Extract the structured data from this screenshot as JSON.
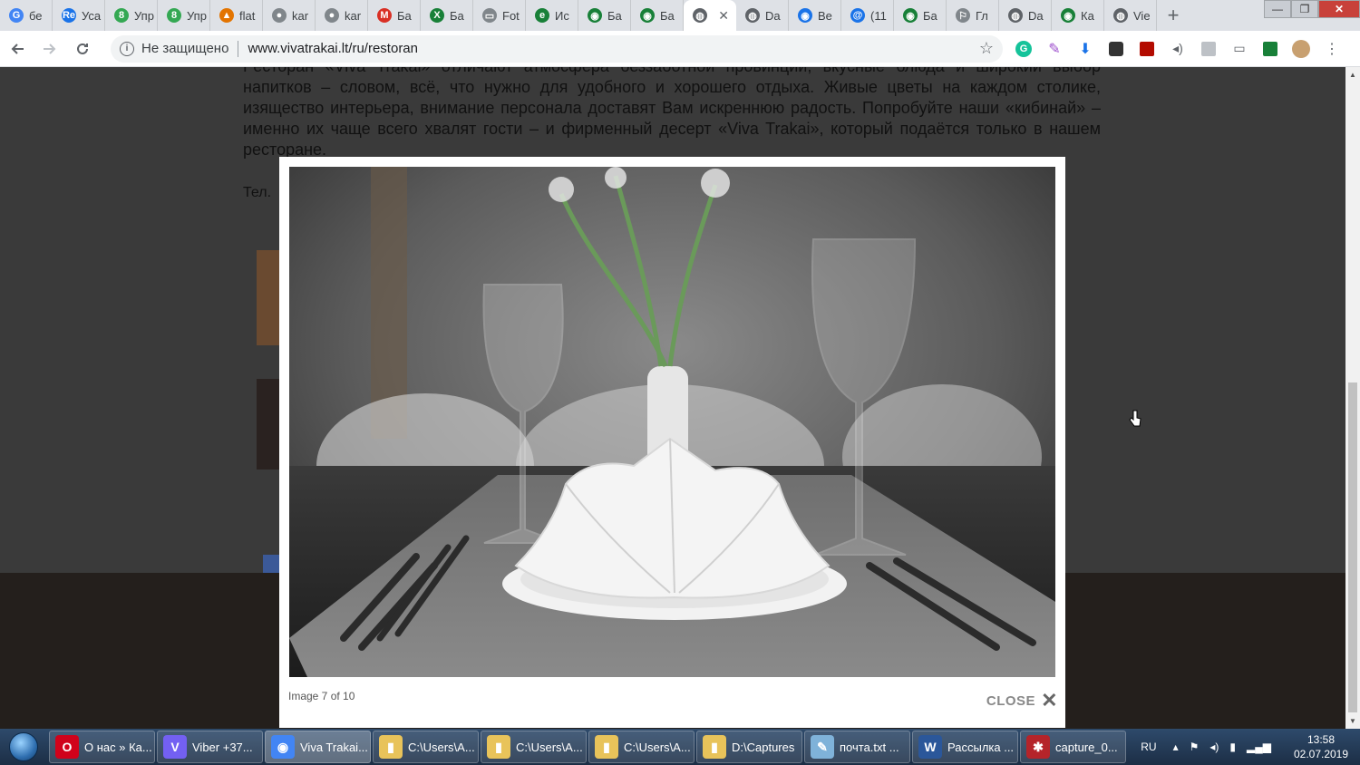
{
  "browser": {
    "tabs": [
      {
        "label": "бе",
        "icon": "G",
        "color": "#4285f4"
      },
      {
        "label": "Уса",
        "icon": "Re",
        "color": "#1a73e8"
      },
      {
        "label": "Упр",
        "icon": "8",
        "color": "#34a853"
      },
      {
        "label": "Упр",
        "icon": "8",
        "color": "#34a853"
      },
      {
        "label": "flat",
        "icon": "▲",
        "color": "#e37400"
      },
      {
        "label": "kar",
        "icon": "●",
        "color": "#80868b"
      },
      {
        "label": "kar",
        "icon": "●",
        "color": "#80868b"
      },
      {
        "label": "Ба",
        "icon": "M",
        "color": "#d93025"
      },
      {
        "label": "Ба",
        "icon": "X",
        "color": "#188038"
      },
      {
        "label": "Fot",
        "icon": "▭",
        "color": "#80868b"
      },
      {
        "label": "Ис",
        "icon": "e",
        "color": "#188038"
      },
      {
        "label": "Ба",
        "icon": "◉",
        "color": "#188038"
      },
      {
        "label": "Ба",
        "icon": "◉",
        "color": "#188038"
      },
      {
        "label": "",
        "icon": "◍",
        "color": "#5f6368",
        "active": true
      },
      {
        "label": "Da",
        "icon": "◍",
        "color": "#5f6368"
      },
      {
        "label": "Ве",
        "icon": "◉",
        "color": "#1a73e8"
      },
      {
        "label": "(11",
        "icon": "@",
        "color": "#1a73e8"
      },
      {
        "label": "Ба",
        "icon": "◉",
        "color": "#188038"
      },
      {
        "label": "Гл",
        "icon": "⚐",
        "color": "#80868b"
      },
      {
        "label": "Da",
        "icon": "◍",
        "color": "#5f6368"
      },
      {
        "label": "Ка",
        "icon": "◉",
        "color": "#188038"
      },
      {
        "label": "Vie",
        "icon": "◍",
        "color": "#5f6368"
      }
    ],
    "active_tab_close": "✕",
    "new_tab": "+",
    "window_controls": {
      "minimize": "—",
      "restore": "❐",
      "close": "✕"
    },
    "security_label": "Не защищено",
    "url": "www.vivatrakai.lt/ru/restoran"
  },
  "page": {
    "article_text": "Ресторан «Viva Trakai» отличают атмосфера беззаботной провинции, вкусные блюда и широкий выбор напитков – словом, всё, что нужно для удобного и хорошего отдыха. Живые цветы на каждом столике, изящество интерьера, внимание персонала доставят Вам искреннюю радость. Попробуйте наши «кибинай» – именно их чаще всего хвалят гости – и фирменный десерт «Viva Trakai», который подаётся только в нашем ресторане.",
    "tel_label": "Тел."
  },
  "lightbox": {
    "caption": "Image 7 of 10",
    "close_label": "CLOSE",
    "close_icon": "✕"
  },
  "taskbar": {
    "tasks": [
      {
        "label": "О нас » Ка...",
        "icon": "O",
        "color": "#d0021b"
      },
      {
        "label": "Viber +37...",
        "icon": "V",
        "color": "#7360f2"
      },
      {
        "label": "Viva Trakai...",
        "icon": "◉",
        "color": "#4285f4",
        "active": true
      },
      {
        "label": "C:\\Users\\A...",
        "icon": "▮",
        "color": "#e8c35a"
      },
      {
        "label": "C:\\Users\\A...",
        "icon": "▮",
        "color": "#e8c35a"
      },
      {
        "label": "C:\\Users\\A...",
        "icon": "▮",
        "color": "#e8c35a"
      },
      {
        "label": "D:\\Captures",
        "icon": "▮",
        "color": "#e8c35a"
      },
      {
        "label": "почта.txt ...",
        "icon": "✎",
        "color": "#7fb2d9"
      },
      {
        "label": "Рассылка ...",
        "icon": "W",
        "color": "#2b579a"
      },
      {
        "label": "capture_0...",
        "icon": "✱",
        "color": "#b5242a"
      }
    ],
    "lang": "RU",
    "time": "13:58",
    "date": "02.07.2019"
  }
}
